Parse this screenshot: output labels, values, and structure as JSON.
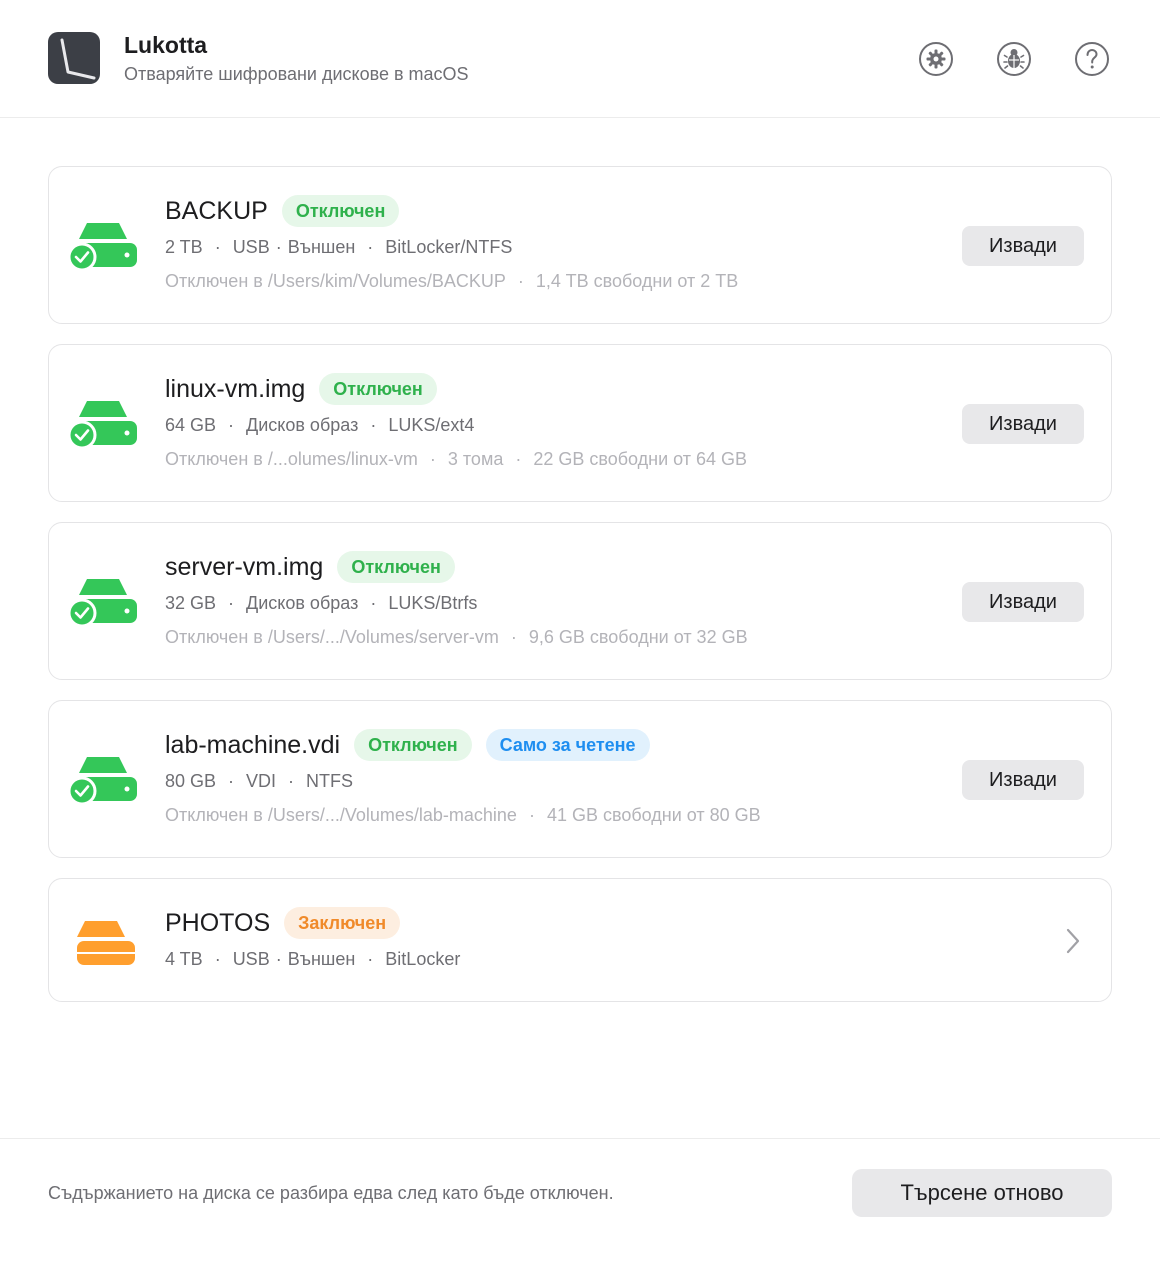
{
  "app": {
    "title": "Lukotta",
    "subtitle": "Отваряйте шифровани дискове в macOS",
    "icons": [
      "settings-gear-icon",
      "bug-icon",
      "help-icon"
    ]
  },
  "colors": {
    "unlocked": "#34c759",
    "locked": "#ff9f2e",
    "read_only": "#1e8ef0"
  },
  "disks": [
    {
      "name": "BACKUP",
      "status": "Отключен",
      "size": "2 TB",
      "bus": "USB",
      "bus_sep": "·",
      "kind": "Външен",
      "format": "BitLocker/NTFS",
      "mount": "Отключен в /Users/kim/Volumes/BACKUP",
      "free": "1,4 TB свободни от 2 TB",
      "action": "Извади"
    },
    {
      "name": "linux-vm.img",
      "status": "Отключен",
      "size": "64 GB",
      "kind": "Дисков образ",
      "format": "LUKS/ext4",
      "mount": "Отключен в /...olumes/linux-vm",
      "volumes": "3 тома",
      "free": "22 GB свободни от 64 GB",
      "action": "Извади"
    },
    {
      "name": "server-vm.img",
      "status": "Отключен",
      "size": "32 GB",
      "kind": "Дисков образ",
      "format": "LUKS/Btrfs",
      "mount": "Отключен в /Users/.../Volumes/server-vm",
      "free": "9,6 GB свободни от 32 GB",
      "action": "Извади"
    },
    {
      "name": "lab-machine.vdi",
      "status": "Отключен",
      "extra_badge": "Само за четене",
      "size": "80 GB",
      "kind": "VDI",
      "format": "NTFS",
      "mount": "Отключен в /Users/.../Volumes/lab-machine",
      "free": "41 GB свободни от 80 GB",
      "action": "Извади"
    },
    {
      "name": "PHOTOS",
      "status": "Заключен",
      "size": "4 TB",
      "bus": "USB",
      "bus_sep": "·",
      "kind": "Външен",
      "format": "BitLocker"
    }
  ],
  "separator": "·",
  "footer": {
    "note": "Съдържанието на диска се разбира едва след като бъде отключен.",
    "rescan": "Търсене отново"
  }
}
